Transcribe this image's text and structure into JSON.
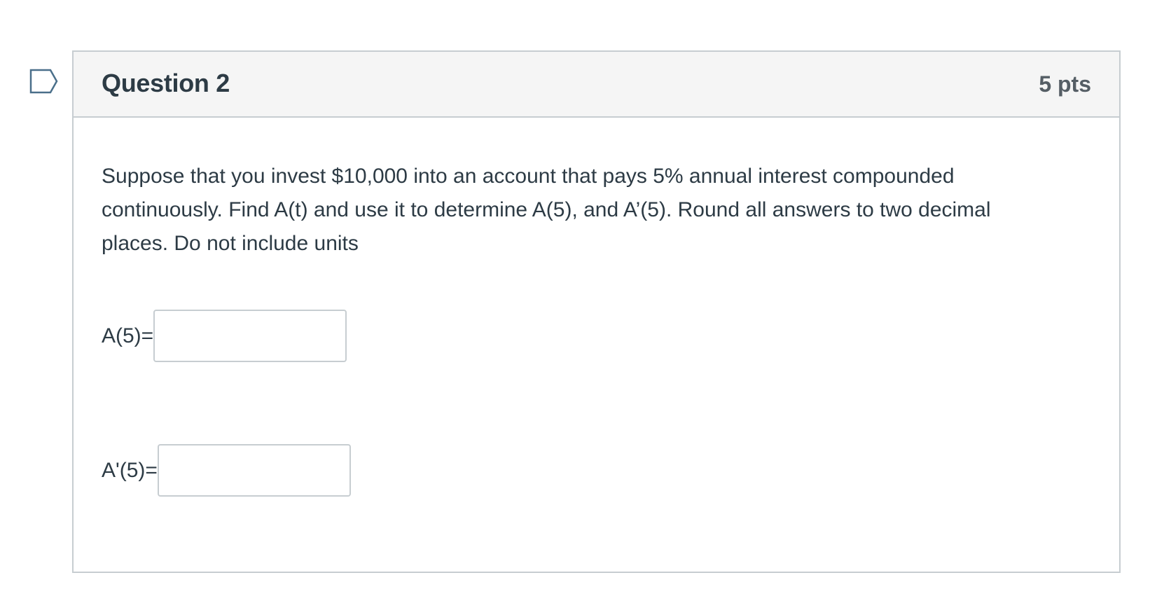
{
  "question": {
    "title": "Question 2",
    "points": "5 pts",
    "text_lines": [
      "Suppose that you invest $10,000 into an account that pays 5% annual interest compounded",
      "continuously.  Find A(t) and use it to determine  A(5), and A’(5).  Round all answers to two decimal",
      "places.  Do not include units"
    ],
    "answers": [
      {
        "label": "A(5)=",
        "value": ""
      },
      {
        "label": "A'(5)=",
        "value": ""
      }
    ]
  },
  "icons": {
    "flag": "bookmark-flag-icon"
  },
  "colors": {
    "header_bg": "#f5f5f5",
    "border": "#c7cdd1",
    "text": "#2d3b45",
    "flag_outline": "#4a6f8a"
  }
}
